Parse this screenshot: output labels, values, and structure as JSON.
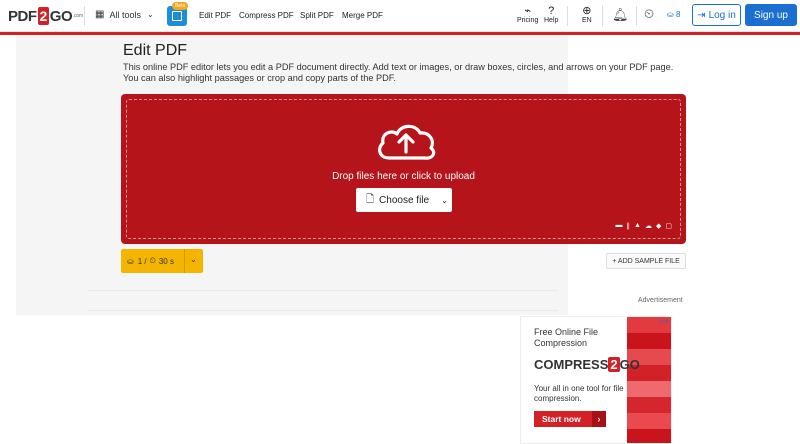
{
  "header": {
    "logo": {
      "part1": "PDF",
      "part2": "2",
      "part3": "GO",
      "suffix": ".com"
    },
    "all_tools": "All tools",
    "beta_badge": "Beta",
    "nav": [
      "Edit PDF",
      "Compress PDF",
      "Split PDF",
      "Merge PDF"
    ],
    "pricing": "Pricing",
    "help": "Help",
    "language": "EN",
    "credits": "8",
    "login": "Log in",
    "signup": "Sign up"
  },
  "main": {
    "title": "Edit PDF",
    "description": "This online PDF editor lets you edit a PDF document directly. Add text or images, or draw boxes, circles, and arrows on your PDF page. You can also highlight passages or crop and copy parts of the PDF.",
    "drop_text": "Drop files here or click to upload",
    "choose_file": "Choose file",
    "limit_files": "1 /",
    "limit_time": "30 s",
    "add_sample": "+ ADD SAMPLE FILE"
  },
  "ad": {
    "label": "Advertisement",
    "headline": "Free Online File Compression",
    "brand_part1": "COMPRESS",
    "brand_part2": "2",
    "brand_part3": "GO",
    "subtext": "Your all in one tool for file compression.",
    "cta": "Start now"
  },
  "colors": {
    "accent": "#d32128",
    "dropzone": "#b5141b",
    "primary_blue": "#1a6fd1",
    "limit_bar": "#f5b400"
  }
}
